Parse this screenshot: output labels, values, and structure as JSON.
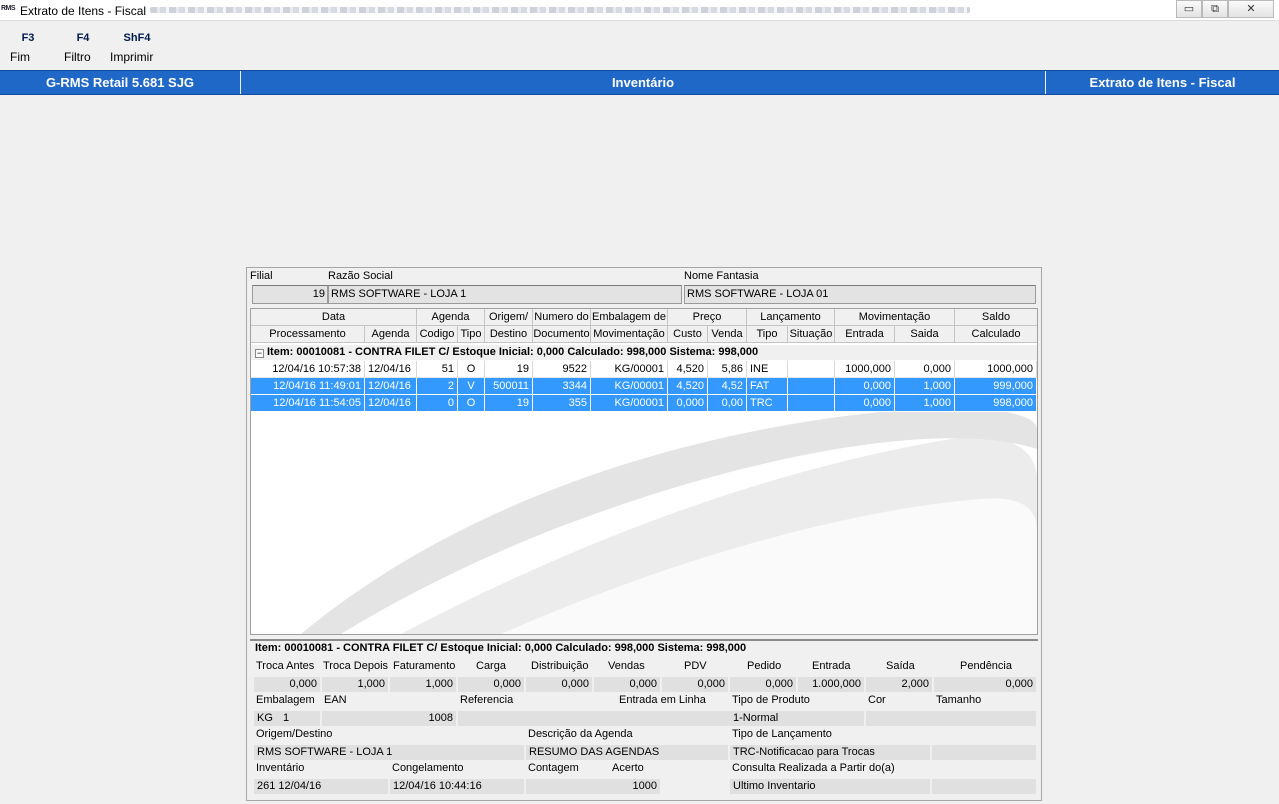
{
  "window": {
    "app_icon": "RMS",
    "title": "Extrato de Itens - Fiscal",
    "buttons": {
      "minimize": "▭",
      "restore": "⧉",
      "close": "✕"
    }
  },
  "toolbar": [
    {
      "key": "F3",
      "label": "Fim"
    },
    {
      "key": "F4",
      "label": "Filtro"
    },
    {
      "key": "ShF4",
      "label": "Imprimir"
    }
  ],
  "header_bar": {
    "left": "G-RMS Retail 5.681 SJG",
    "center": "Inventário",
    "right": "Extrato de Itens - Fiscal"
  },
  "filial": {
    "label": "Filial",
    "value": "19"
  },
  "razao": {
    "label": "Razão Social",
    "value": "RMS SOFTWARE - LOJA 1"
  },
  "fantasia": {
    "label": "Nome Fantasia",
    "value": "RMS SOFTWARE - LOJA 01"
  },
  "grid": {
    "header_top": [
      "Data",
      "Agenda",
      "Origem/",
      "Numero do",
      "Embalagem de",
      "Preço",
      "Lançamento",
      "Movimentação",
      "Saldo"
    ],
    "header_bottom": [
      "Processamento",
      "Agenda",
      "Codigo",
      "Tipo",
      "Destino",
      "Documento",
      "Movimentação",
      "Custo",
      "Venda",
      "Tipo",
      "Situação",
      "Entrada",
      "Saida",
      "Calculado"
    ],
    "group_expander": "−",
    "group_label": "Item: 00010081 - CONTRA FILET C/  Estoque Inicial: 0,000  Calculado: 998,000  Sistema: 998,000",
    "rows": [
      [
        "12/04/16 10:57:38",
        "12/04/16",
        "51",
        "O",
        "19",
        "9522",
        "KG/00001",
        "4,520",
        "5,86",
        "INE",
        "",
        "1000,000",
        "0,000",
        "1000,000"
      ],
      [
        "12/04/16 11:49:01",
        "12/04/16",
        "2",
        "V",
        "500011",
        "3344",
        "KG/00001",
        "4,520",
        "4,52",
        "FAT",
        "",
        "0,000",
        "1,000",
        "999,000"
      ],
      [
        "12/04/16 11:54:05",
        "12/04/16",
        "0",
        "O",
        "19",
        "355",
        "KG/00001",
        "0,000",
        "0,00",
        "TRC",
        "",
        "0,000",
        "1,000",
        "998,000"
      ]
    ],
    "selected_rows": [
      1,
      2
    ]
  },
  "summary": {
    "title": "Item: 00010081 - CONTRA FILET C/  Estoque Inicial: 0,000  Calculado: 998,000  Sistema: 998,000",
    "labels": [
      "Troca Antes",
      "Troca Depois",
      "Faturamento",
      "Carga",
      "Distribuição",
      "Vendas",
      "PDV",
      "Pedido",
      "Entrada",
      "Saída",
      "Pendência"
    ],
    "values": [
      "0,000",
      "1,000",
      "1,000",
      "0,000",
      "0,000",
      "0,000",
      "0,000",
      "0,000",
      "1.000,000",
      "2,000",
      "0,000"
    ],
    "embalagem_label": "Embalagem",
    "embalagem_unit": "KG",
    "embalagem_qty": "1",
    "ean_label": "EAN",
    "ean_value": "1008",
    "referencia_label": "Referencia",
    "entrada_linha_label": "Entrada em Linha",
    "tipo_produto_label": "Tipo de Produto",
    "tipo_produto_value": "1-Normal",
    "cor_label": "Cor",
    "tamanho_label": "Tamanho",
    "origem_label": "Origem/Destino",
    "origem_value": "RMS SOFTWARE - LOJA 1",
    "desc_agenda_label": "Descrição da Agenda",
    "desc_agenda_value": "RESUMO DAS AGENDAS",
    "tipo_lanc_label": "Tipo de Lançamento",
    "tipo_lanc_value": "TRC-Notificacao para Trocas",
    "inventario_label": "Inventário",
    "inventario_value": "261 12/04/16",
    "congelamento_label": "Congelamento",
    "congelamento_value": "12/04/16 10:44:16",
    "contagem_label": "Contagem",
    "acerto_label": "Acerto",
    "acerto_value": "1000",
    "consulta_label": "Consulta Realizada a Partir do(a)",
    "consulta_value": "Ultimo Inventario"
  },
  "colors": {
    "accent": "#1f68c8",
    "selection": "#3399ff"
  }
}
